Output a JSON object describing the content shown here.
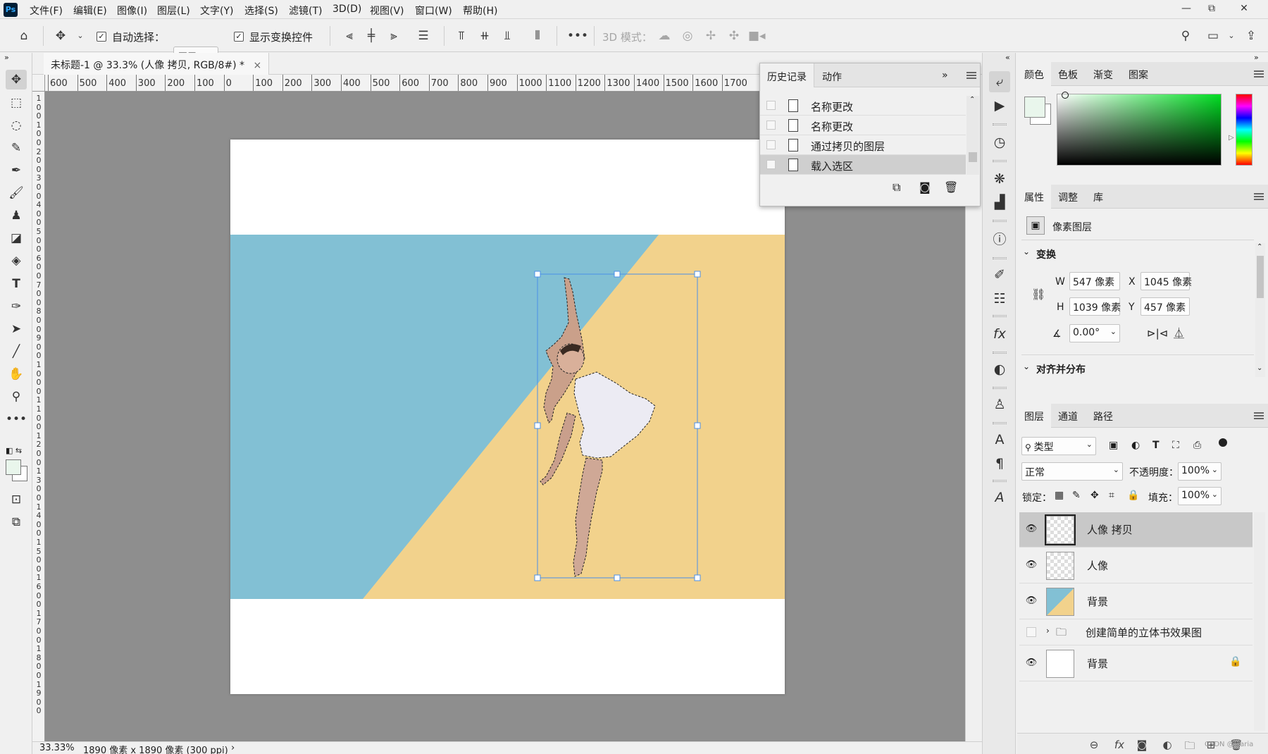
{
  "menubar": {
    "logo": "Ps",
    "items": [
      "文件(F)",
      "编辑(E)",
      "图像(I)",
      "图层(L)",
      "文字(Y)",
      "选择(S)",
      "滤镜(T)",
      "3D(D)",
      "视图(V)",
      "窗口(W)",
      "帮助(H)"
    ],
    "window_controls": {
      "minimize": "—",
      "restore": "⧉",
      "close": "✕"
    }
  },
  "options": {
    "auto_select_label": "自动选择：",
    "auto_select_value": "图层",
    "show_transform_label": "显示变换控件",
    "threed_mode_label": "3D 模式："
  },
  "document": {
    "tab_title": "未标题-1 @ 33.3% (人像 拷贝, RGB/8#) *",
    "tab_close": "×",
    "ruler_h": [
      "600",
      "500",
      "400",
      "300",
      "200",
      "100",
      "0",
      "100",
      "200",
      "300",
      "400",
      "500",
      "600",
      "700",
      "800",
      "900",
      "1000",
      "1100",
      "1200",
      "1300",
      "1400",
      "1500",
      "1600",
      "1700"
    ],
    "ruler_v": [
      "1",
      "0",
      "0",
      "1",
      "0",
      "0",
      "2",
      "0",
      "0",
      "3",
      "0",
      "0",
      "4",
      "0",
      "0",
      "5",
      "0",
      "0",
      "6",
      "0",
      "0",
      "7",
      "0",
      "0",
      "8",
      "0",
      "0",
      "9",
      "0",
      "0",
      "1",
      "0",
      "0",
      "0",
      "1",
      "1",
      "0",
      "0",
      "1",
      "2",
      "0",
      "0",
      "1",
      "3",
      "0",
      "0",
      "1",
      "4",
      "0",
      "0",
      "1",
      "5",
      "0",
      "0",
      "1",
      "6",
      "0",
      "0",
      "1",
      "7",
      "0",
      "0",
      "1",
      "8",
      "0",
      "0",
      "1",
      "9",
      "0",
      "0"
    ],
    "zoom": "33.33%",
    "size": "1890 像素 x 1890 像素 (300 ppi)",
    "status_arrow": "›",
    "colors": {
      "blue": "#82c0d4",
      "yellow": "#f2d28c"
    }
  },
  "history": {
    "tabs": [
      "历史记录",
      "动作"
    ],
    "expand": "»",
    "items": [
      "名称更改",
      "名称更改",
      "通过拷贝的图层",
      "载入选区"
    ],
    "selected_index": 3
  },
  "color_panel": {
    "tabs": [
      "颜色",
      "色板",
      "渐变",
      "图案"
    ],
    "foreground": "#e9f6ec",
    "background": "#ffffff",
    "hue": "#00dd22"
  },
  "properties": {
    "tabs": [
      "属性",
      "调整",
      "库"
    ],
    "layer_type": "像素图层",
    "transform_title": "变换",
    "w_label": "W",
    "w_value": "547 像素",
    "x_label": "X",
    "x_value": "1045 像素",
    "h_label": "H",
    "h_value": "1039 像素",
    "y_label": "Y",
    "y_value": "457 像素",
    "angle_value": "0.00°",
    "align_title": "对齐并分布"
  },
  "layers": {
    "tabs": [
      "图层",
      "通道",
      "路径"
    ],
    "filter_label": "类型",
    "blend_mode": "正常",
    "opacity_label": "不透明度：",
    "opacity_value": "100%",
    "lock_label": "锁定：",
    "fill_label": "填充：",
    "fill_value": "100%",
    "items": [
      {
        "name": "人像 拷贝",
        "visible": true,
        "selected": true
      },
      {
        "name": "人像",
        "visible": true
      },
      {
        "name": "背景",
        "visible": true
      },
      {
        "name": "创建简单的立体书效果图",
        "visible": false,
        "group": true
      },
      {
        "name": "背景",
        "visible": true,
        "locked": true
      }
    ],
    "watermark": "CSDN @Icaria"
  }
}
